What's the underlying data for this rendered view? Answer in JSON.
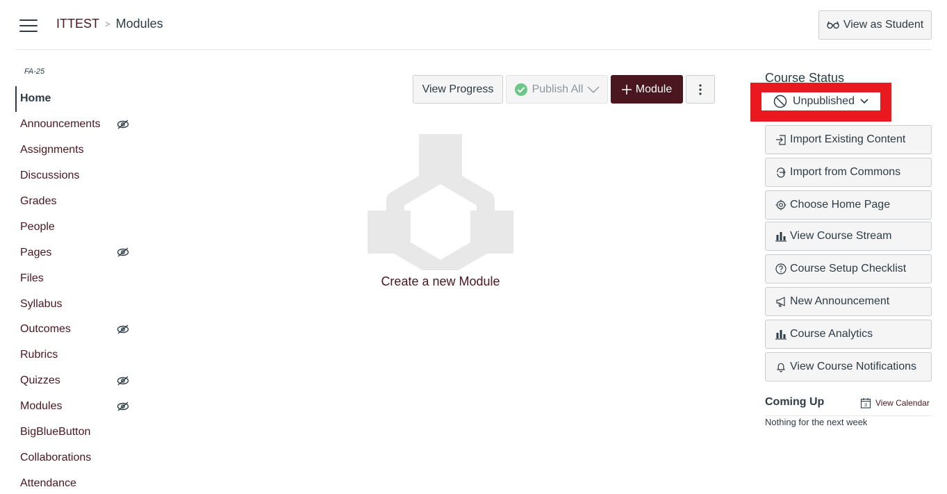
{
  "header": {
    "course": "ITTEST",
    "separator": ">",
    "current": "Modules",
    "view_as_student": "View as Student"
  },
  "sidebar": {
    "term": "FA-25",
    "items": [
      {
        "label": "Home"
      },
      {
        "label": "Announcements"
      },
      {
        "label": "Assignments"
      },
      {
        "label": "Discussions"
      },
      {
        "label": "Grades"
      },
      {
        "label": "People"
      },
      {
        "label": "Pages"
      },
      {
        "label": "Files"
      },
      {
        "label": "Syllabus"
      },
      {
        "label": "Outcomes"
      },
      {
        "label": "Rubrics"
      },
      {
        "label": "Quizzes"
      },
      {
        "label": "Modules"
      },
      {
        "label": "BigBlueButton"
      },
      {
        "label": "Collaborations"
      },
      {
        "label": "Attendance"
      }
    ]
  },
  "toolbar": {
    "view_progress": "View Progress",
    "publish_all": "Publish All",
    "module": "Module"
  },
  "empty_state": {
    "text": "Create a new Module"
  },
  "right": {
    "course_status_title": "Course Status",
    "status_value": "Unpublished",
    "buttons": [
      {
        "label": "Import Existing Content",
        "icon": "import-icon"
      },
      {
        "label": "Import from Commons",
        "icon": "commons-icon"
      },
      {
        "label": "Choose Home Page",
        "icon": "target-icon"
      },
      {
        "label": "View Course Stream",
        "icon": "bar-chart-icon"
      },
      {
        "label": "Course Setup Checklist",
        "icon": "question-icon"
      },
      {
        "label": "New Announcement",
        "icon": "megaphone-icon"
      },
      {
        "label": "Course Analytics",
        "icon": "bar-chart-icon"
      },
      {
        "label": "View Course Notifications",
        "icon": "bell-icon"
      }
    ],
    "coming_up": "Coming Up",
    "calendar_day": "3",
    "view_calendar": "View Calendar",
    "nothing": "Nothing for the next week"
  },
  "colors": {
    "brand": "#4a1620",
    "highlight": "#e8191f",
    "publish_check": "#6cc789"
  }
}
